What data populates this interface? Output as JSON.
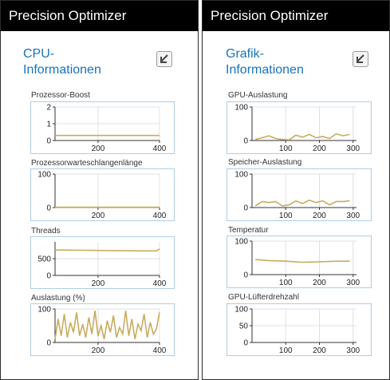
{
  "cpu_panel": {
    "title": "Precision Optimizer",
    "section_title_line1": "CPU-",
    "section_title_line2": "Informationen",
    "collapse_icon": "collapse-arrow-icon",
    "metrics": [
      {
        "label": "Prozessor-Boost",
        "y_ticks": [
          "2",
          "1",
          "0"
        ],
        "x_ticks": [
          "200",
          "400"
        ]
      },
      {
        "label": "Prozessorwarteschlangenlänge",
        "y_ticks": [
          "100",
          "0"
        ],
        "x_ticks": [
          "200",
          "400"
        ]
      },
      {
        "label": "Threads",
        "y_ticks": [
          "500",
          "0"
        ],
        "x_ticks": [
          "200",
          "400"
        ]
      },
      {
        "label": "Auslastung (%)",
        "y_ticks": [
          "100",
          "0"
        ],
        "x_ticks": [
          "200",
          "400"
        ]
      }
    ]
  },
  "gpu_panel": {
    "title": "Precision Optimizer",
    "section_title_line1": "Grafik-",
    "section_title_line2": "Informationen",
    "collapse_icon": "collapse-arrow-icon",
    "metrics": [
      {
        "label": "GPU-Auslastung",
        "y_ticks": [
          "100",
          "0"
        ],
        "x_ticks": [
          "100",
          "200",
          "300"
        ]
      },
      {
        "label": "Speicher-Auslastung",
        "y_ticks": [
          "100",
          "0"
        ],
        "x_ticks": [
          "100",
          "200",
          "300"
        ]
      },
      {
        "label": "Temperatur",
        "y_ticks": [
          "100",
          "0"
        ],
        "x_ticks": [
          "100",
          "200",
          "300"
        ]
      },
      {
        "label": "GPU-Lüfterdrehzahl",
        "y_ticks": [
          "100",
          "50",
          "0"
        ],
        "x_ticks": [
          "100",
          "200",
          "300"
        ]
      }
    ]
  },
  "colors": {
    "series": "#c8ac5e",
    "section_title": "#1a73b8",
    "chart_border": "#aecde4",
    "grid": "#e0e0e0"
  },
  "chart_data": [
    {
      "type": "line",
      "title": "Prozessor-Boost",
      "x": [
        60,
        100,
        150,
        200,
        250,
        300,
        350,
        400
      ],
      "series": [
        {
          "values": [
            0.3,
            0.3,
            0.3,
            0.3,
            0.3,
            0.3,
            0.3,
            0.3
          ]
        }
      ],
      "xlim": [
        60,
        400
      ],
      "ylim": [
        0,
        2
      ],
      "grid": true
    },
    {
      "type": "line",
      "title": "Prozessorwarteschlangenlänge",
      "x": [
        60,
        100,
        150,
        200,
        250,
        300,
        350,
        400
      ],
      "series": [
        {
          "values": [
            1,
            1,
            1,
            1,
            1,
            1,
            1,
            1
          ]
        }
      ],
      "xlim": [
        60,
        400
      ],
      "ylim": [
        0,
        100
      ],
      "grid": true
    },
    {
      "type": "line",
      "title": "Threads",
      "x": [
        60,
        100,
        150,
        200,
        250,
        300,
        350,
        390,
        400
      ],
      "series": [
        {
          "values": [
            760,
            755,
            750,
            745,
            740,
            735,
            730,
            730,
            790
          ]
        }
      ],
      "xlim": [
        60,
        400
      ],
      "ylim": [
        0,
        1000
      ],
      "grid": true
    },
    {
      "type": "line",
      "title": "Auslastung (%)",
      "x": [
        60,
        70,
        80,
        90,
        100,
        110,
        120,
        130,
        140,
        150,
        160,
        170,
        180,
        190,
        200,
        210,
        220,
        230,
        240,
        250,
        260,
        270,
        280,
        290,
        300,
        310,
        320,
        330,
        340,
        350,
        360,
        370,
        380,
        390,
        400
      ],
      "series": [
        {
          "values": [
            10,
            70,
            20,
            85,
            15,
            60,
            30,
            90,
            20,
            55,
            15,
            75,
            25,
            95,
            20,
            50,
            10,
            65,
            30,
            80,
            15,
            45,
            25,
            95,
            20,
            70,
            10,
            55,
            35,
            85,
            15,
            60,
            25,
            40,
            90
          ]
        }
      ],
      "xlim": [
        60,
        400
      ],
      "ylim": [
        0,
        100
      ],
      "grid": true
    },
    {
      "type": "line",
      "title": "GPU-Auslastung",
      "x": [
        10,
        30,
        50,
        70,
        90,
        110,
        130,
        150,
        170,
        190,
        210,
        230,
        250,
        270,
        290
      ],
      "series": [
        {
          "values": [
            3,
            8,
            14,
            6,
            3,
            2,
            16,
            10,
            18,
            8,
            12,
            6,
            20,
            14,
            18
          ]
        }
      ],
      "xlim": [
        0,
        310
      ],
      "ylim": [
        0,
        100
      ],
      "grid": true
    },
    {
      "type": "line",
      "title": "Speicher-Auslastung",
      "x": [
        10,
        30,
        50,
        70,
        90,
        110,
        130,
        150,
        170,
        190,
        210,
        230,
        250,
        270,
        290
      ],
      "series": [
        {
          "values": [
            5,
            18,
            15,
            18,
            5,
            8,
            20,
            12,
            22,
            15,
            20,
            8,
            18,
            18,
            20
          ]
        }
      ],
      "xlim": [
        0,
        310
      ],
      "ylim": [
        0,
        100
      ],
      "grid": true
    },
    {
      "type": "line",
      "title": "Temperatur",
      "x": [
        10,
        50,
        100,
        150,
        200,
        250,
        290
      ],
      "series": [
        {
          "values": [
            45,
            42,
            40,
            37,
            38,
            40,
            40
          ]
        }
      ],
      "xlim": [
        0,
        310
      ],
      "ylim": [
        0,
        100
      ],
      "grid": true
    },
    {
      "type": "line",
      "title": "GPU-Lüfterdrehzahl",
      "x": [],
      "series": [
        {
          "values": []
        }
      ],
      "xlim": [
        0,
        310
      ],
      "ylim": [
        0,
        100
      ],
      "grid": true
    }
  ]
}
